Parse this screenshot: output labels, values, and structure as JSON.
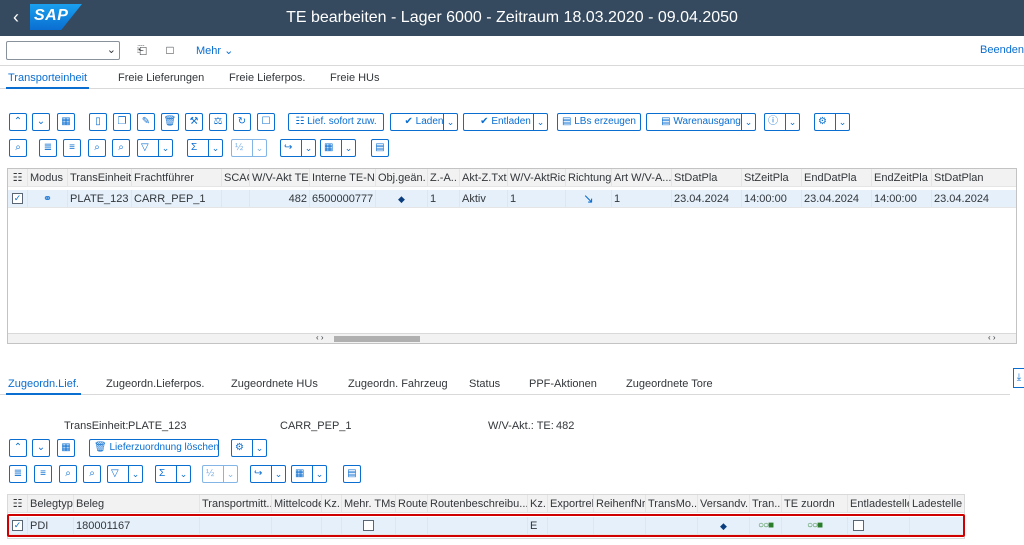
{
  "shell": {
    "logo": "SAP",
    "title": "TE bearbeiten - Lager 6000 - Zeitraum  18.03.2020 - 09.04.2050"
  },
  "toolbar": {
    "combo_value": "",
    "mehr_label": "Mehr",
    "beenden_label": "Beenden"
  },
  "top_tabs": [
    "Transporteinheit",
    "Freie Lieferungen",
    "Freie Lieferpos.",
    "Freie HUs"
  ],
  "upper_toolbar": {
    "lief_sofort": "Lief. sofort zuw.",
    "laden": "Laden",
    "entladen": "Entladen",
    "lbs_erzeugen": "LBs erzeugen",
    "warenausgang": "Warenausgang"
  },
  "upper_grid": {
    "headers": [
      "Modus",
      "TransEinheit",
      "Frachtführer",
      "SCAC",
      "W/V-Akt TE",
      "Interne TE-Nr",
      "Obj.geän.",
      "Z.-A..",
      "Akt-Z.Txt",
      "W/V-AktRic",
      "Richtung",
      "Art W/V-A...",
      "StDatPla",
      "StZeitPla",
      "EndDatPla",
      "EndZeitPla",
      "StDatPlan"
    ],
    "row": {
      "modus": "⚭",
      "transeinheit": "PLATE_123",
      "frachtfuehrer": "CARR_PEP_1",
      "scac": "",
      "wv_akt_te": "482",
      "interne_te_nr": "6500000777",
      "obj_gean": "◆",
      "z_a": "1",
      "akt_z_txt": "Aktiv",
      "wv_aktric": "1",
      "richtung": "↘",
      "art_wv": "1",
      "stdatpla": "23.04.2024",
      "stzeitpla": "14:00:00",
      "enddatpla": "23.04.2024",
      "endzeitpla": "14:00:00",
      "stdatplan": "23.04.2024"
    }
  },
  "bottom_tabs": [
    "Zugeordn.Lief.",
    "Zugeordn.Lieferpos.",
    "Zugeordnete HUs",
    "Zugeordn. Fahrzeug",
    "Status",
    "PPF-Aktionen",
    "Zugeordnete Tore"
  ],
  "info": {
    "transeinheit_label": "TransEinheit:",
    "transeinheit_value": "PLATE_123",
    "carrier": "CARR_PEP_1",
    "wv_label": "W/V-Akt.: TE:",
    "wv_value": "482"
  },
  "lower_toolbar": {
    "lieferzuordnung_loeschen": "Lieferzuordnung löschen"
  },
  "lower_grid": {
    "headers": [
      "Belegtyp",
      "Beleg",
      "Transportmitt...",
      "Mittelcode",
      "Kz.",
      "Mehr. TMs",
      "Route",
      "Routenbeschreibu...",
      "Kz.",
      "Exportrel",
      "ReihenfNr",
      "TransMo...",
      "Versandv.",
      "Tran...",
      "TE zuordn",
      "Entladestelle",
      "Ladestelle"
    ],
    "row": {
      "belegtyp": "PDI",
      "beleg": "180001167",
      "kz2": "E",
      "versandv": "◆",
      "tran": "○○■",
      "te_zuordn": "○○■"
    }
  }
}
